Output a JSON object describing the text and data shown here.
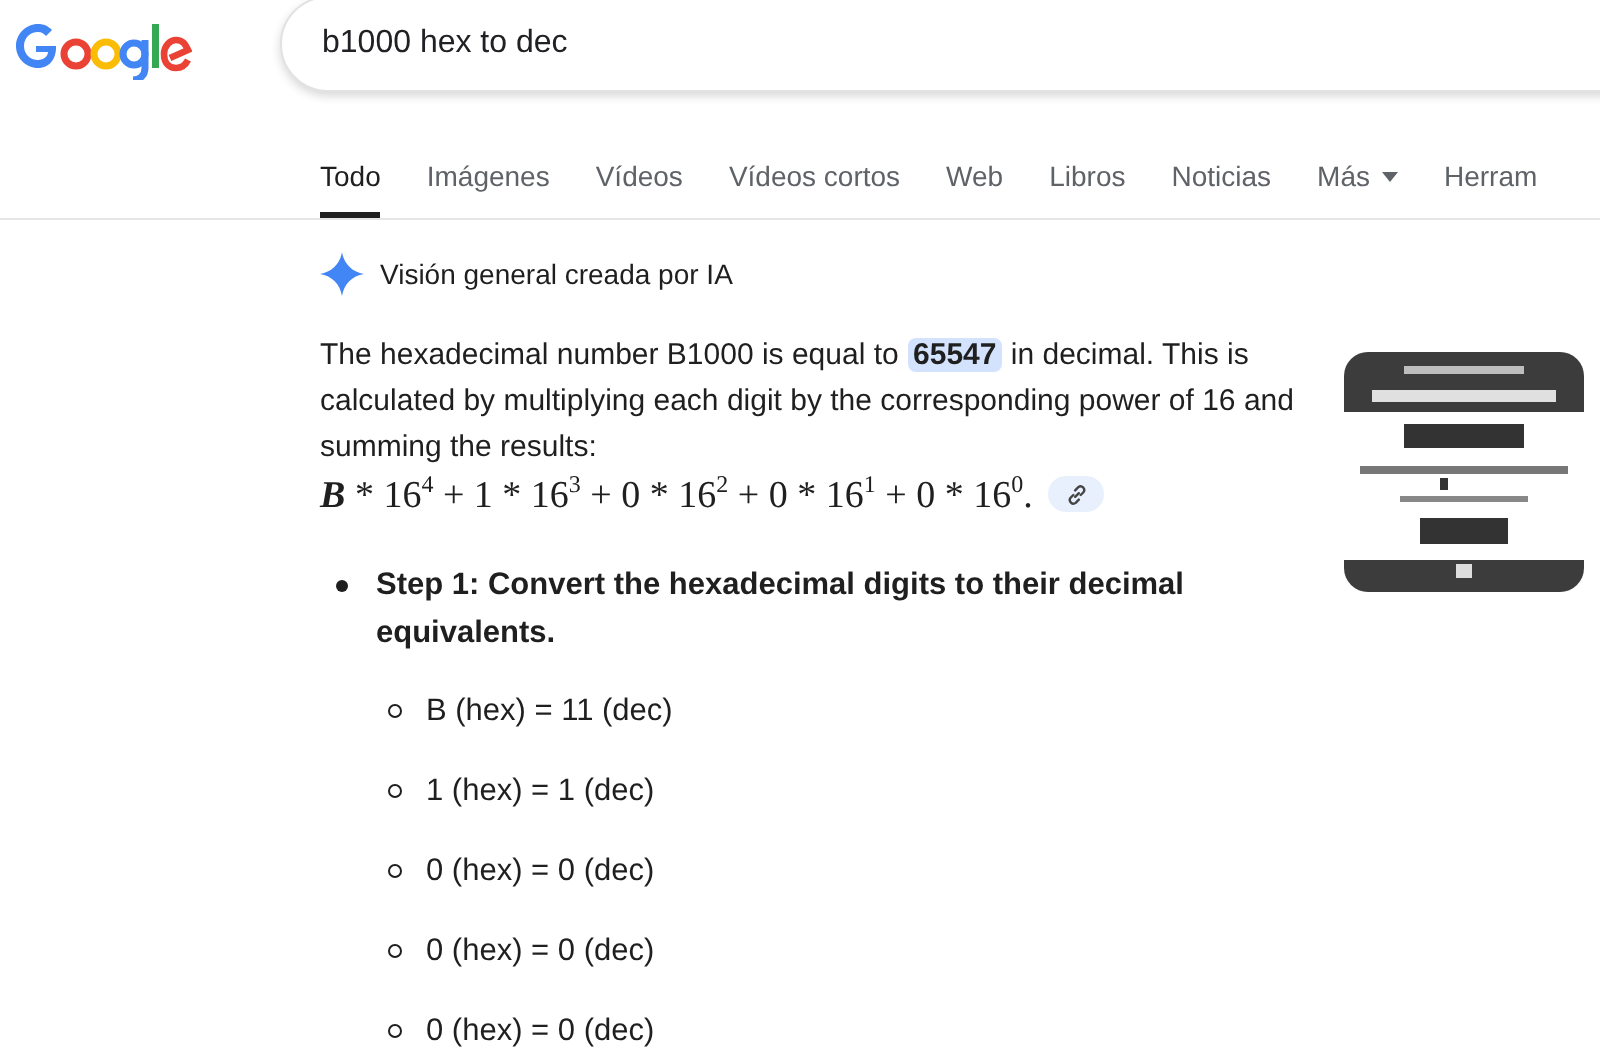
{
  "search": {
    "value": "b1000 hex to dec"
  },
  "tabs": [
    {
      "label": "Todo",
      "selected": true,
      "dropdown": false
    },
    {
      "label": "Imágenes",
      "selected": false,
      "dropdown": false
    },
    {
      "label": "Vídeos",
      "selected": false,
      "dropdown": false
    },
    {
      "label": "Vídeos cortos",
      "selected": false,
      "dropdown": false
    },
    {
      "label": "Web",
      "selected": false,
      "dropdown": false
    },
    {
      "label": "Libros",
      "selected": false,
      "dropdown": false
    },
    {
      "label": "Noticias",
      "selected": false,
      "dropdown": false
    },
    {
      "label": "Más",
      "selected": false,
      "dropdown": true
    },
    {
      "label": "Herram",
      "selected": false,
      "dropdown": false
    }
  ],
  "ai_overview": {
    "title": "Visión general creada por IA",
    "intro": "The hexadecimal number B1000 is equal to **65547** in decimal. This is calculated by multiplying each digit by the corresponding power of 16 and summing the results:",
    "formula": {
      "plus": "+",
      "end": ".",
      "terms": [
        {
          "coef": "B",
          "kind": "variable",
          "op": "*",
          "base": "16",
          "exp": "4"
        },
        {
          "coef": "1",
          "kind": "number",
          "op": "*",
          "base": "16",
          "exp": "3"
        },
        {
          "coef": "0",
          "kind": "number",
          "op": "*",
          "base": "16",
          "exp": "2"
        },
        {
          "coef": "0",
          "kind": "number",
          "op": "*",
          "base": "16",
          "exp": "1"
        },
        {
          "coef": "0",
          "kind": "number",
          "op": "*",
          "base": "16",
          "exp": "0"
        }
      ]
    },
    "steps": [
      {
        "title": "Step 1: Convert the hexadecimal digits to their decimal equivalents.",
        "items": [
          "B (hex) = 11 (dec)",
          "1 (hex) = 1 (dec)",
          "0 (hex) = 0 (dec)",
          "0 (hex) = 0 (dec)",
          "0 (hex) = 0 (dec)"
        ]
      }
    ]
  }
}
